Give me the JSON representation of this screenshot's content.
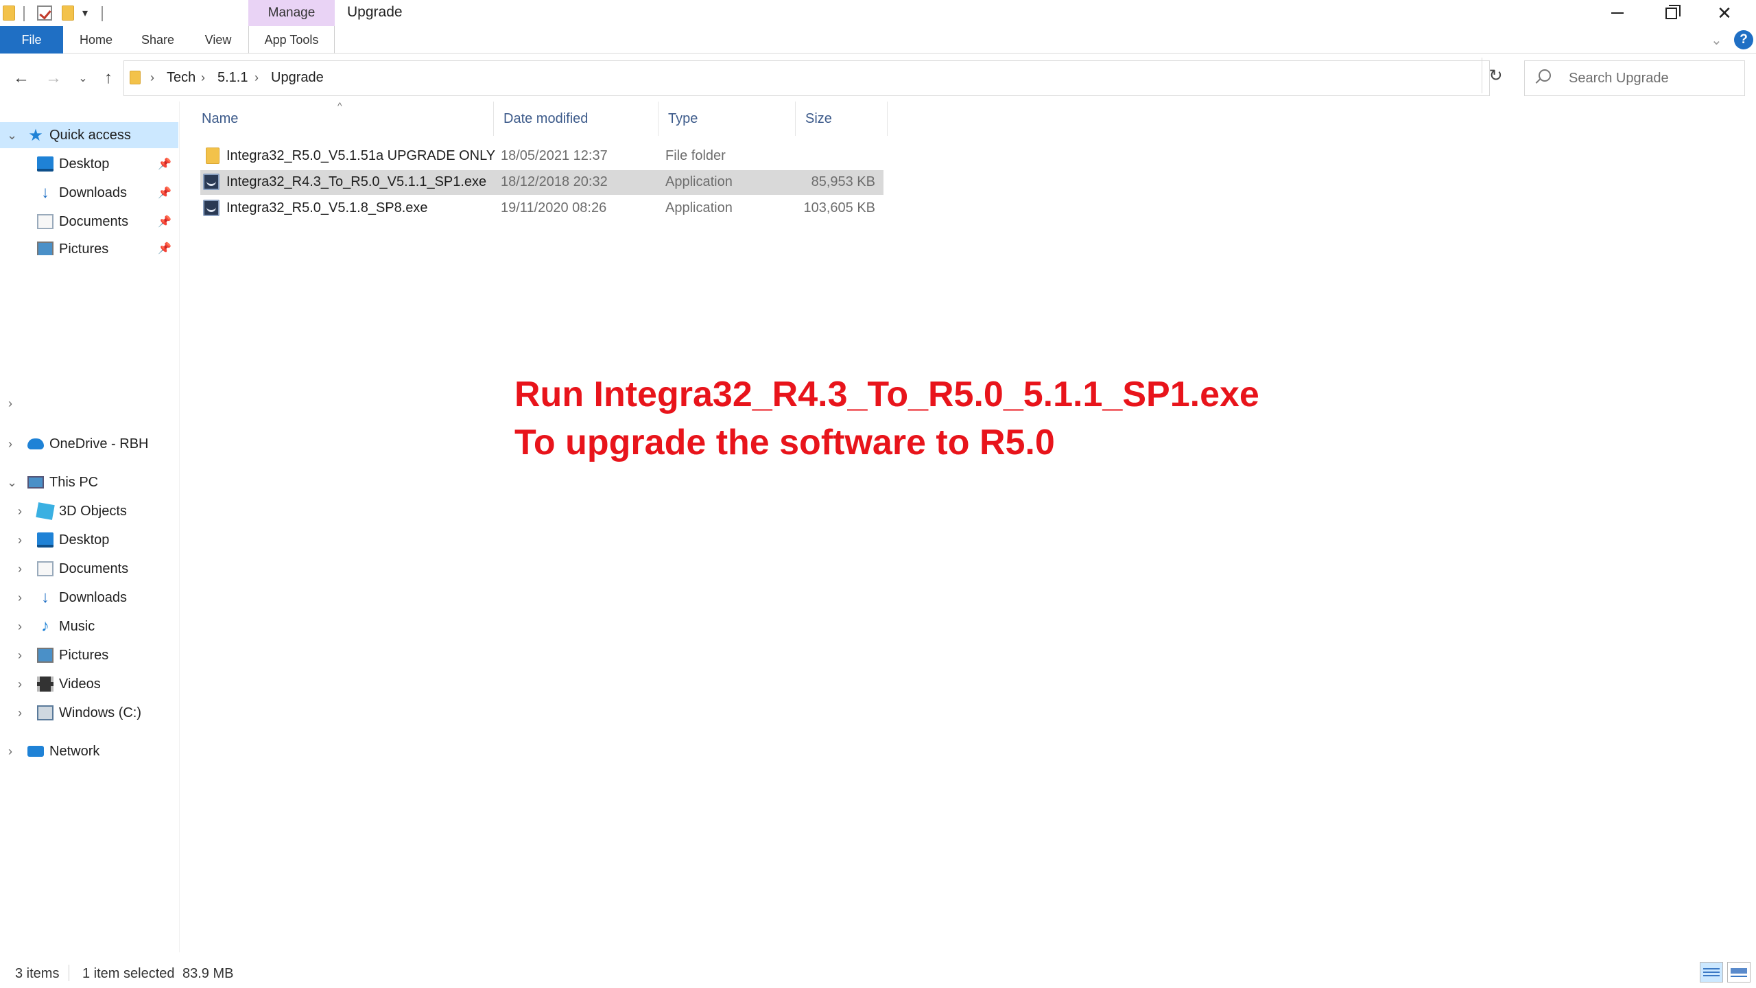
{
  "window": {
    "context_tab": "Manage",
    "title": "Upgrade"
  },
  "ribbon": {
    "tabs": [
      "File",
      "Home",
      "Share",
      "View",
      "App Tools"
    ]
  },
  "help_label": "?",
  "address": {
    "breadcrumbs": [
      "Tech",
      "5.1.1",
      "Upgrade"
    ],
    "search_placeholder": "Search Upgrade"
  },
  "sidebar": {
    "quick_access": {
      "label": "Quick access",
      "items": [
        "Desktop",
        "Downloads",
        "Documents",
        "Pictures"
      ]
    },
    "onedrive": "OneDrive - RBH",
    "this_pc": {
      "label": "This PC",
      "items": [
        "3D Objects",
        "Desktop",
        "Documents",
        "Downloads",
        "Music",
        "Pictures",
        "Videos",
        "Windows (C:)"
      ]
    },
    "network": "Network"
  },
  "columns": [
    "Name",
    "Date modified",
    "Type",
    "Size"
  ],
  "files": [
    {
      "name": "Integra32_R5.0_V5.1.51a UPGRADE ONLY",
      "date": "18/05/2021 12:37",
      "type": "File folder",
      "size": "",
      "icon": "folder-icon",
      "selected": false
    },
    {
      "name": "Integra32_R4.3_To_R5.0_V5.1.1_SP1.exe",
      "date": "18/12/2018 20:32",
      "type": "Application",
      "size": "85,953 KB",
      "icon": "app-icon",
      "selected": true
    },
    {
      "name": "Integra32_R5.0_V5.1.8_SP8.exe",
      "date": "19/11/2020 08:26",
      "type": "Application",
      "size": "103,605 KB",
      "icon": "app-icon",
      "selected": false
    }
  ],
  "annotation": {
    "line1": "Run Integra32_R4.3_To_R5.0_5.1.1_SP1.exe",
    "line2": "To upgrade the software to R5.0",
    "color": "#e8141b"
  },
  "status": {
    "count": "3 items",
    "selection": "1 item selected",
    "selection_size": "83.9 MB"
  },
  "colors": {
    "accent": "#1f6fc4",
    "selected_nav": "#cce8ff",
    "selected_row": "#d9d9d9",
    "context_tab": "#e9d3f5"
  }
}
